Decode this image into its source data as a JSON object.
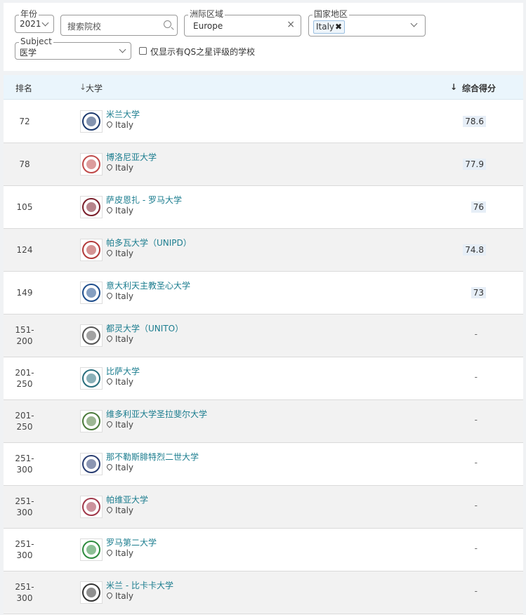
{
  "filters": {
    "year": {
      "label": "年份",
      "value": "2021"
    },
    "search": {
      "placeholder": "搜索院校"
    },
    "region": {
      "label": "洲际区域",
      "value": "Europe",
      "clear": "×"
    },
    "country": {
      "label": "国家地区",
      "chip": "Italy",
      "chip_remove": "✖"
    },
    "subject": {
      "label": "Subject",
      "value": "医学"
    },
    "stars_only": {
      "label": "仅显示有QS之星评级的学校",
      "checked": false
    }
  },
  "table": {
    "headers": {
      "rank": "排名",
      "university": "大学",
      "score": "综合得分"
    },
    "rows": [
      {
        "rank": "72",
        "name": "米兰大学",
        "location": "Italy",
        "score": "78.6",
        "logo_color": "#1d3a6e"
      },
      {
        "rank": "78",
        "name": "博洛尼亚大学",
        "location": "Italy",
        "score": "77.9",
        "logo_color": "#c04a4a"
      },
      {
        "rank": "105",
        "name": "萨皮恩扎 - 罗马大学",
        "location": "Italy",
        "score": "76",
        "logo_color": "#7a1f2b"
      },
      {
        "rank": "124",
        "name": "帕多瓦大学（UNIPD）",
        "location": "Italy",
        "score": "74.8",
        "logo_color": "#b23a3a"
      },
      {
        "rank": "149",
        "name": "意大利天主教圣心大学",
        "location": "Italy",
        "score": "73",
        "logo_color": "#1f4e8c"
      },
      {
        "rank": "151-\n200",
        "name": "都灵大学（UNITO）",
        "location": "Italy",
        "score": "-",
        "logo_color": "#555555"
      },
      {
        "rank": "201-\n250",
        "name": "比萨大学",
        "location": "Italy",
        "score": "-",
        "logo_color": "#2a6f7d"
      },
      {
        "rank": "201-\n250",
        "name": "维多利亚大学圣拉斐尔大学",
        "location": "Italy",
        "score": "-",
        "logo_color": "#4a7a3a"
      },
      {
        "rank": "251-\n300",
        "name": "那不勒斯腓特烈二世大学",
        "location": "Italy",
        "score": "-",
        "logo_color": "#2b3f73"
      },
      {
        "rank": "251-\n300",
        "name": "帕维亚大学",
        "location": "Italy",
        "score": "-",
        "logo_color": "#a0384a"
      },
      {
        "rank": "251-\n300",
        "name": "罗马第二大学",
        "location": "Italy",
        "score": "-",
        "logo_color": "#2e8b3e"
      },
      {
        "rank": "251-\n300",
        "name": "米兰 - 比卡卡大学",
        "location": "Italy",
        "score": "-",
        "logo_color": "#333333"
      }
    ]
  }
}
